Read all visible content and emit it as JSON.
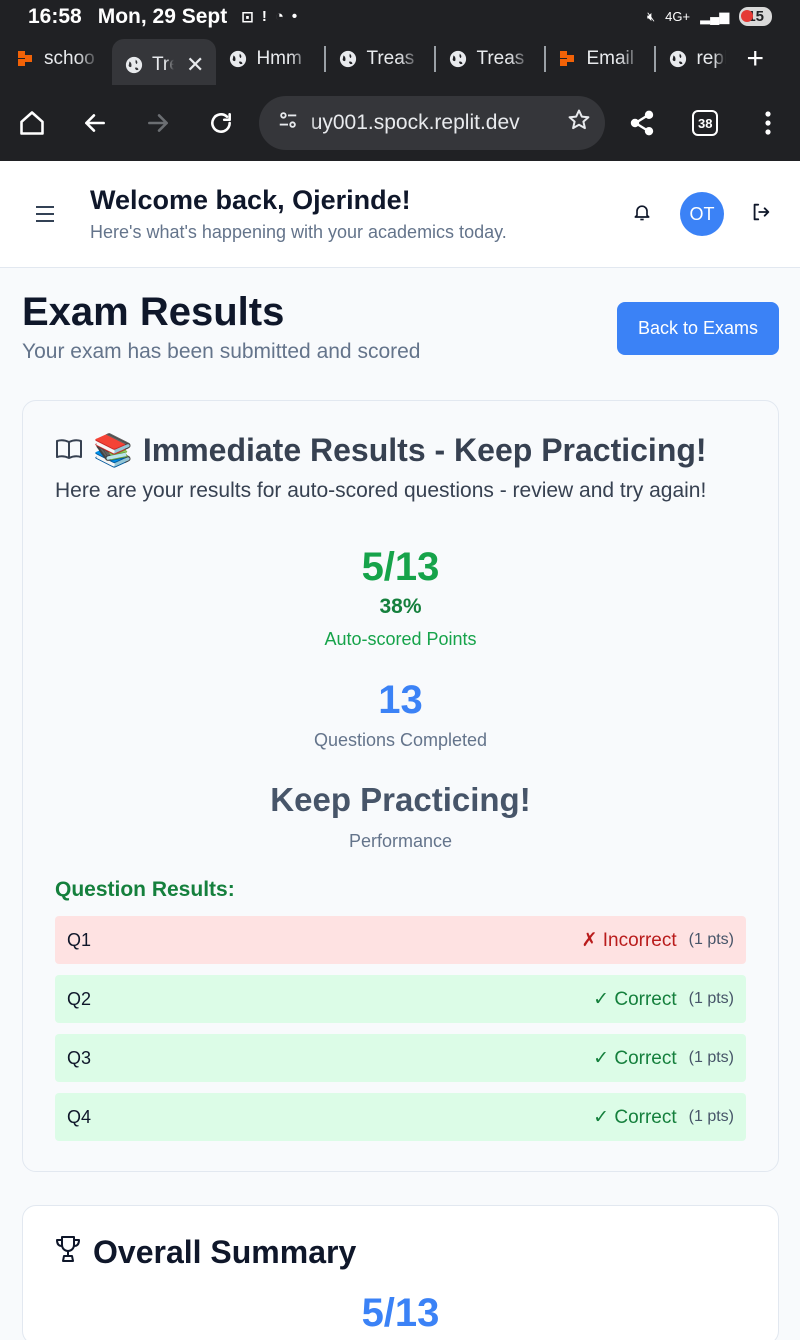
{
  "status_bar": {
    "time": "16:58",
    "date": "Mon, 29 Sept",
    "network": "4G+",
    "battery": "15"
  },
  "tabs": [
    {
      "label": "schoo",
      "icon": "replit-icon",
      "active": false
    },
    {
      "label": "Tre",
      "icon": "globe-icon",
      "active": true
    },
    {
      "label": "Hmm",
      "icon": "globe-icon",
      "active": false
    },
    {
      "label": "Treas",
      "icon": "globe-icon",
      "active": false
    },
    {
      "label": "Treas",
      "icon": "globe-icon",
      "active": false
    },
    {
      "label": "Email",
      "icon": "replit-icon",
      "active": false
    },
    {
      "label": "repl",
      "icon": "globe-icon",
      "active": false
    }
  ],
  "toolbar": {
    "url": "uy001.spock.replit.dev",
    "tab_count": "38"
  },
  "header": {
    "title": "Welcome back, Ojerinde!",
    "subtitle": "Here's what's happening with your academics today.",
    "avatar_initials": "OT"
  },
  "page": {
    "title": "Exam Results",
    "subtitle": "Your exam has been submitted and scored",
    "back_button": "Back to Exams"
  },
  "results_card": {
    "emoji": "📚",
    "title": "Immediate Results - Keep Practicing!",
    "description": "Here are your results for auto-scored questions - review and try again!",
    "score": "5/13",
    "percent": "38%",
    "score_label": "Auto-scored Points",
    "completed": "13",
    "completed_label": "Questions Completed",
    "performance": "Keep Practicing!",
    "performance_label": "Performance",
    "question_results_title": "Question Results:",
    "questions": [
      {
        "q": "Q1",
        "status": "✗ Incorrect",
        "pts": "(1 pts)",
        "correct": false
      },
      {
        "q": "Q2",
        "status": "✓ Correct",
        "pts": "(1 pts)",
        "correct": true
      },
      {
        "q": "Q3",
        "status": "✓ Correct",
        "pts": "(1 pts)",
        "correct": true
      },
      {
        "q": "Q4",
        "status": "✓ Correct",
        "pts": "(1 pts)",
        "correct": true
      }
    ]
  },
  "summary_card": {
    "title": "Overall Summary",
    "peek_value": "5/13"
  },
  "colors": {
    "accent": "#3b82f6",
    "success": "#16a34a",
    "error": "#b91c1c",
    "correct_bg": "#dcfce7",
    "incorrect_bg": "#fee2e2"
  }
}
